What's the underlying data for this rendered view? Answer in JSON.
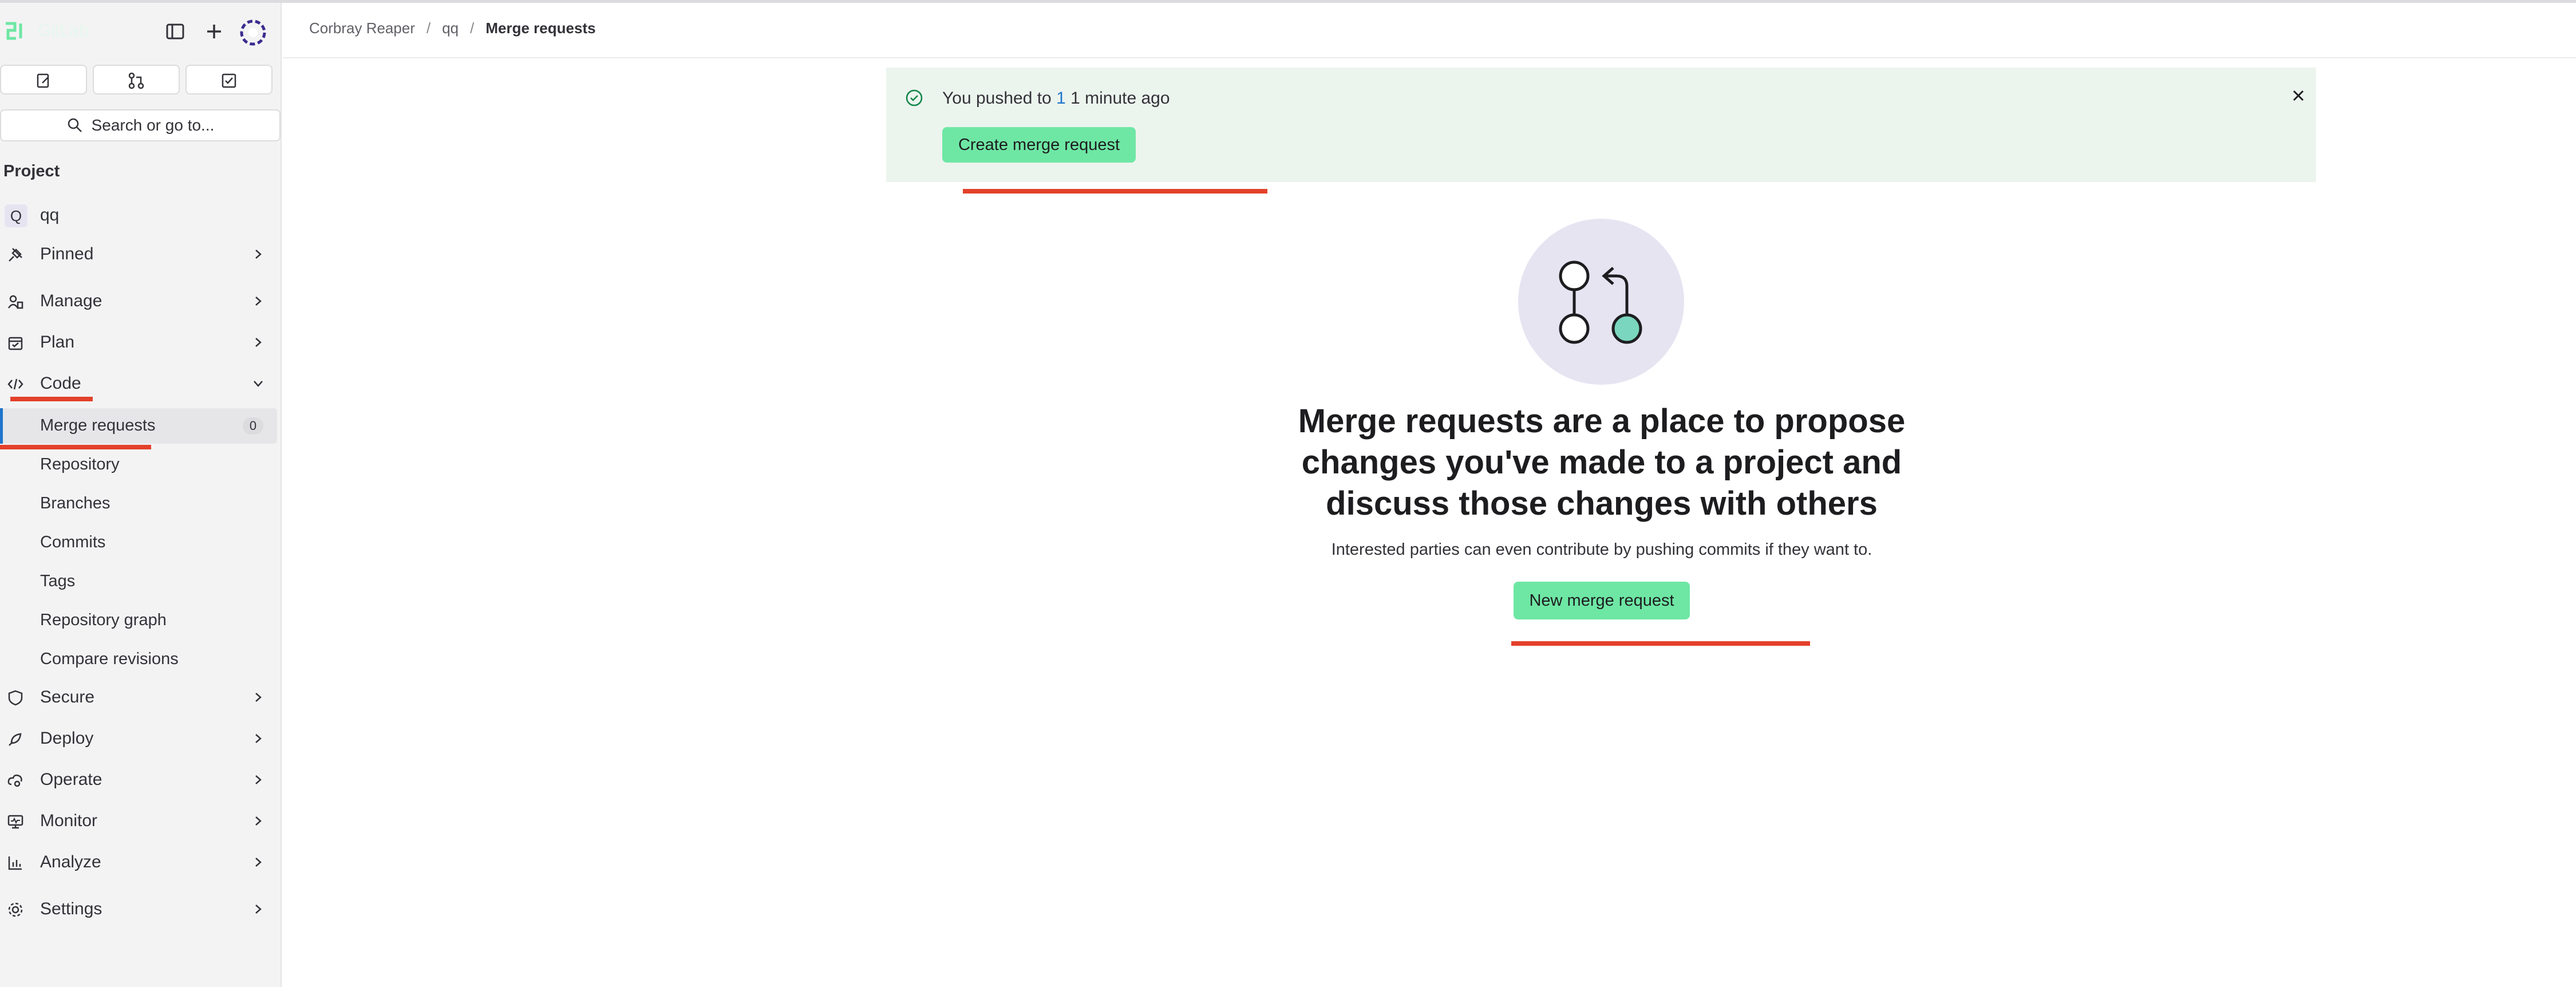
{
  "app": {
    "logo_text": "GitLab"
  },
  "breadcrumb": [
    "Corbray Reaper",
    "qq",
    "Merge requests"
  ],
  "sidebar": {
    "search_label": "Search or go to...",
    "section_title": "Project",
    "project": {
      "badge": "Q",
      "name": "qq"
    },
    "items": {
      "pinned": "Pinned",
      "manage": "Manage",
      "plan": "Plan",
      "code": "Code",
      "secure": "Secure",
      "deploy": "Deploy",
      "operate": "Operate",
      "monitor": "Monitor",
      "analyze": "Analyze",
      "settings": "Settings"
    },
    "code_sub": {
      "merge_requests": "Merge requests",
      "merge_requests_count": "0",
      "repository": "Repository",
      "branches": "Branches",
      "commits": "Commits",
      "tags": "Tags",
      "repository_graph": "Repository graph",
      "compare_revisions": "Compare revisions"
    }
  },
  "alert": {
    "text_before": "You pushed to ",
    "branch": "1",
    "text_after": " 1 minute ago",
    "button": "Create merge request"
  },
  "empty_state": {
    "title": "Merge requests are a place to propose changes you've made to a project and discuss those changes with others",
    "description": "Interested parties can even contribute by pushing commits if they want to.",
    "button": "New merge request"
  },
  "colors": {
    "accent_green": "#6ee7a4",
    "annotation_red": "#e3412b",
    "alert_bg": "#ecf4ee",
    "active_bar": "#1f75cb"
  }
}
